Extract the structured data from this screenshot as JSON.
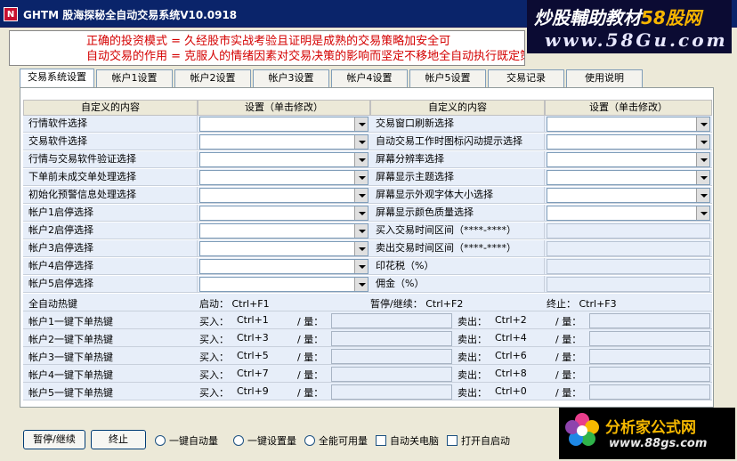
{
  "window": {
    "title": "GHTM 股海探秘全自动交易系统V10.0918",
    "icon_label": "N"
  },
  "watermark": {
    "line1_prefix": "炒股輔助教材",
    "line1_brand": "58股网",
    "line2": "www.58Gu.com"
  },
  "notice": {
    "line1": "正确的投资模式 = 久经股市实战考验且证明是成熟的交易策略加安全可",
    "line2": "自动交易的作用 = 克服人的情绪因素对交易决策的影响而坚定不移地全自动执行既定策略。"
  },
  "tabs": [
    "交易系统设置",
    "帐户1设置",
    "帐户2设置",
    "帐户3设置",
    "帐户4设置",
    "帐户5设置",
    "交易记录",
    "使用说明"
  ],
  "grid": {
    "headers": [
      "自定义的内容",
      "设置（单击修改）",
      "自定义的内容",
      "设置（单击修改）"
    ],
    "left_rows": [
      "行情软件选择",
      "交易软件选择",
      "行情与交易软件验证选择",
      "下单前未成交单处理选择",
      "初始化预警信息处理选择",
      "帐户1启停选择",
      "帐户2启停选择",
      "帐户3启停选择",
      "帐户4启停选择",
      "帐户5启停选择"
    ],
    "right_rows": [
      "交易窗口刷新选择",
      "自动交易工作时图标闪动提示选择",
      "屏幕分辨率选择",
      "屏幕显示主题选择",
      "屏幕显示外观字体大小选择",
      "屏幕显示颜色质量选择",
      "买入交易时间区间（****-****）",
      "卖出交易时间区间（****-****）",
      "印花税（%）",
      "佣金（%）"
    ]
  },
  "hotkeys": {
    "global_label": "全自动热键",
    "start": "启动：  Ctrl+F1",
    "pause": "暂停/继续：  Ctrl+F2",
    "stop": "终止：   Ctrl+F3",
    "buy_label": "买入：",
    "sell_label": "卖出：",
    "qty_label": "/ 量：",
    "accounts": [
      {
        "label": "帐户1一键下单热键",
        "buy": "Ctrl+1",
        "sell": "Ctrl+2"
      },
      {
        "label": "帐户2一键下单热键",
        "buy": "Ctrl+3",
        "sell": "Ctrl+4"
      },
      {
        "label": "帐户3一键下单热键",
        "buy": "Ctrl+5",
        "sell": "Ctrl+6"
      },
      {
        "label": "帐户4一键下单热键",
        "buy": "Ctrl+7",
        "sell": "Ctrl+8"
      },
      {
        "label": "帐户5一键下单热键",
        "buy": "Ctrl+9",
        "sell": "Ctrl+0"
      }
    ]
  },
  "bottom": {
    "pause_button": "暂停/继续",
    "stop_button": "终止",
    "opt_auto_qty": "一键自动量",
    "opt_set_qty": "一键设置量",
    "opt_all_avail": "全能可用量",
    "chk_auto_shutdown": "自动关电脑",
    "chk_autostart": "打开自启动"
  },
  "logo2": {
    "line1": "分析家公式网",
    "line2": "www.88gs.com"
  },
  "colors": {
    "titlebar": "#0a246a",
    "notice_text": "#d40000",
    "cell_bg": "#e7eef9"
  }
}
